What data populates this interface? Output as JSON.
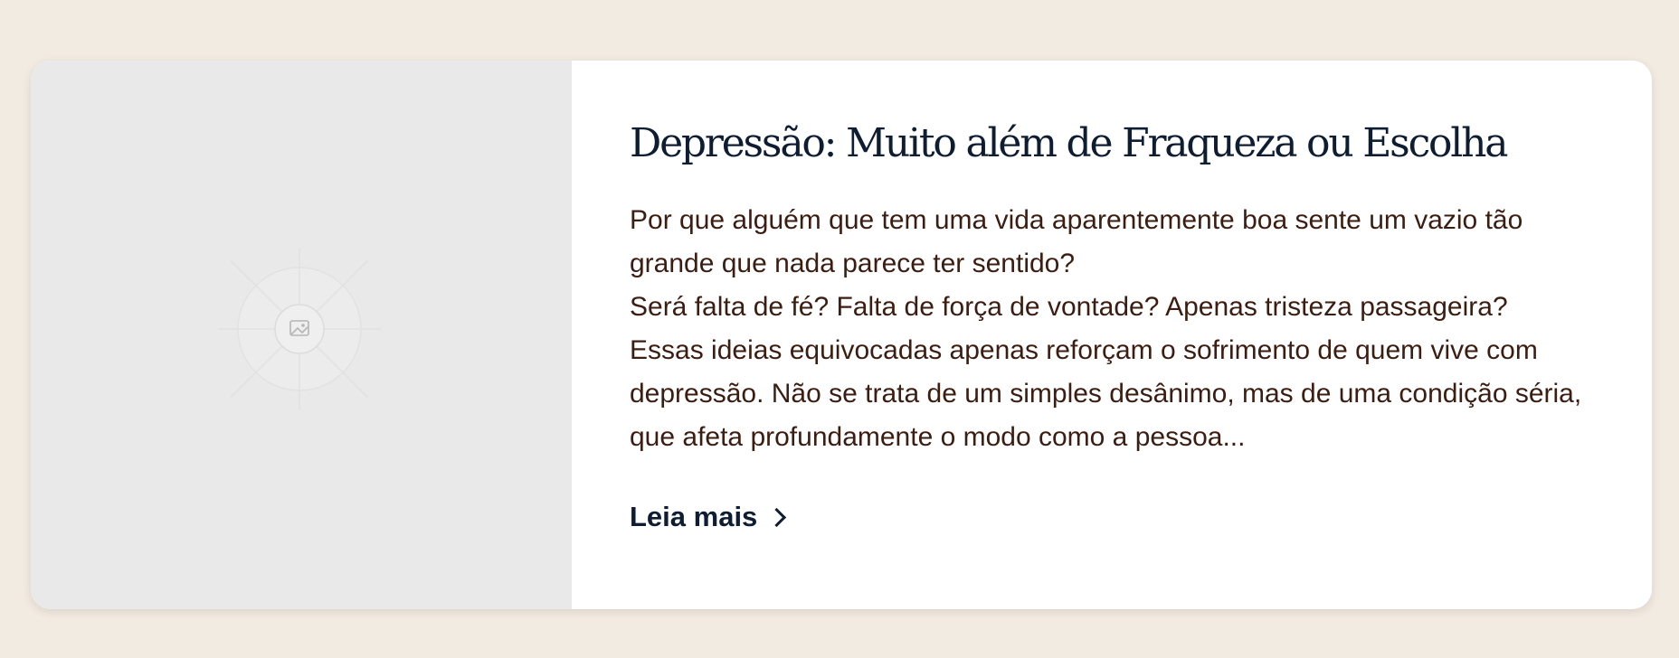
{
  "card": {
    "image_icon": "image-placeholder-icon",
    "title": "Depressão: Muito além de Fraqueza ou Escolha",
    "excerpt_lines": [
      "Por que alguém que tem uma vida aparentemente boa sente um vazio tão grande que nada parece ter sentido?",
      "Será falta de fé? Falta de força de vontade? Apenas tristeza passageira?",
      "Essas ideias equivocadas apenas reforçam o sofrimento de quem vive com depressão. Não se trata de um simples desânimo, mas de uma condição séria, que afeta profundamente o modo como a pessoa..."
    ],
    "read_more_label": "Leia mais",
    "read_more_icon": "chevron-right-icon"
  },
  "colors": {
    "page_background": "#f2ebe2",
    "card_background": "#ffffff",
    "image_area_background": "#e9e9e9",
    "title": "#0f1d33",
    "body_text": "#3b1d12"
  }
}
